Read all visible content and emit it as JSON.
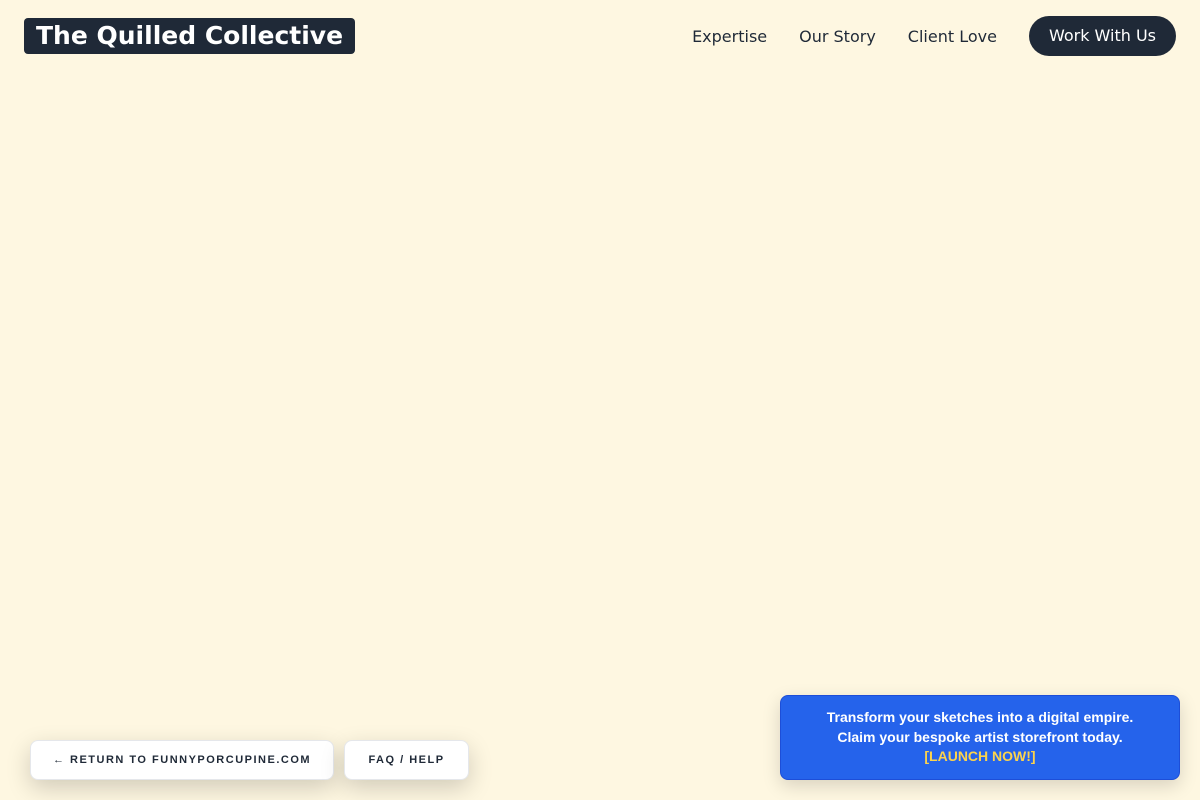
{
  "header": {
    "logo": "The Quilled Collective",
    "nav": [
      {
        "label": "Expertise"
      },
      {
        "label": "Our Story"
      },
      {
        "label": "Client Love"
      }
    ],
    "cta_label": "Work With Us"
  },
  "footer_buttons": {
    "return_label": "← RETURN TO FUNNYPORCUPINE.COM",
    "faq_label": "FAQ / HELP"
  },
  "promo": {
    "line1": "Transform your sketches into a digital empire.",
    "line2": "Claim your bespoke artist storefront today.",
    "link": "[LAUNCH NOW!]"
  },
  "colors": {
    "background": "#fef7e1",
    "dark": "#1f2937",
    "promo_bg": "#2563eb",
    "promo_link": "#fcd34d"
  }
}
